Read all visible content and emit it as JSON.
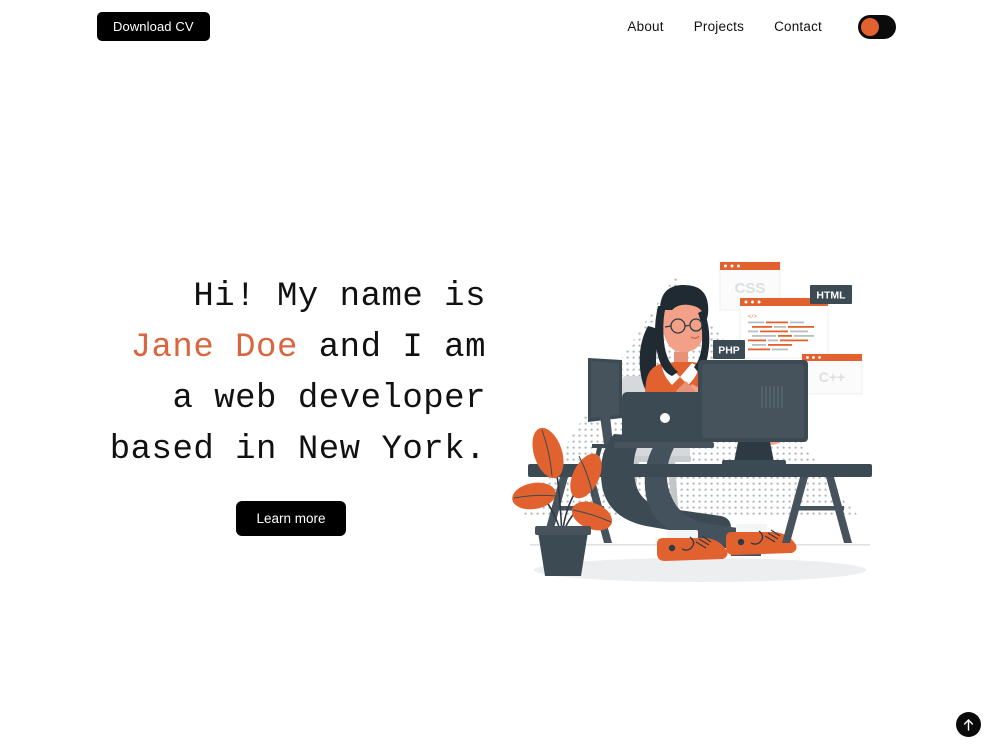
{
  "header": {
    "cv_button_label": "Download CV",
    "nav_items": [
      {
        "label": "About",
        "name": "nav-link-about"
      },
      {
        "label": "Projects",
        "name": "nav-link-projects"
      },
      {
        "label": "Contact",
        "name": "nav-link-contact"
      }
    ],
    "theme_toggle": {
      "state": "off",
      "knob_position": "left"
    }
  },
  "hero": {
    "headline_part1": "Hi! My name is ",
    "headline_accent": "Jane Doe",
    "headline_part2": " and I am a web developer based in New York.",
    "cta_label": "Learn more"
  },
  "illustration": {
    "alt": "woman coding at desk",
    "windows": [
      {
        "label": "CSS",
        "name": "window-css"
      },
      {
        "label": "C++",
        "name": "window-cpp"
      }
    ],
    "badges": [
      {
        "label": "HTML",
        "name": "badge-html"
      },
      {
        "label": "PHP",
        "name": "badge-php"
      }
    ],
    "code_snippet_icon": "</>"
  },
  "footer": {
    "scroll_top_label": "scroll to top"
  },
  "colors": {
    "accent_orange": "#e2622f",
    "headline_orange": "#d9663f",
    "dark": "#000000",
    "navy": "#3c4a54",
    "light_gray": "#c9ccce",
    "background": "#ffffff"
  }
}
